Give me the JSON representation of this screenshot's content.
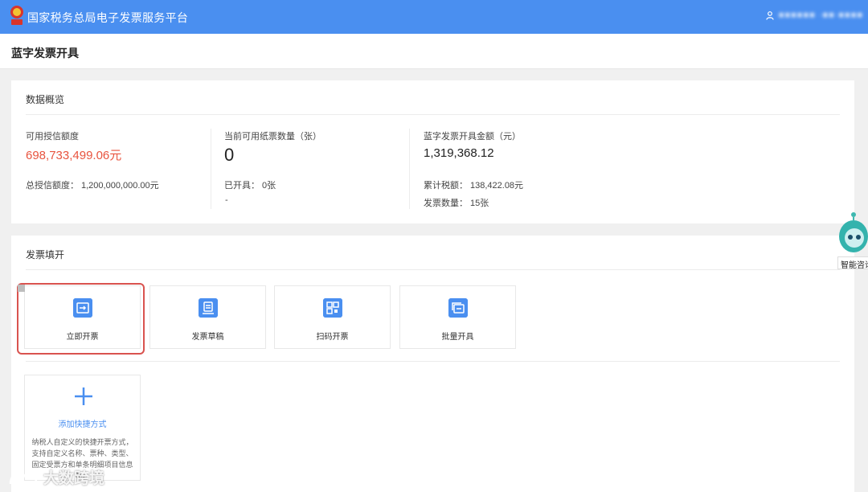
{
  "header": {
    "title": "国家税务总局电子发票服务平台",
    "user": "■■■■■■ ·■■·■■■■"
  },
  "page": {
    "title": "蓝字发票开具"
  },
  "overview": {
    "title": "数据概览",
    "credit": {
      "available_label": "可用授信额度",
      "available_value": "698,733,499.06元",
      "total_label": "总授信额度：",
      "total_value": "1,200,000,000.00元"
    },
    "paper": {
      "label": "当前可用纸票数量（张）",
      "value": "0",
      "issued_label": "已开具：",
      "issued_value": "0张",
      "dash": "-"
    },
    "blue": {
      "label": "蓝字发票开具金额（元）",
      "value": "1,319,368.12",
      "tax_label": "累计税额：",
      "tax_value": "138,422.08元",
      "count_label": "发票数量：",
      "count_value": "15张"
    }
  },
  "fill": {
    "title": "发票填开",
    "tiles": [
      {
        "label": "立即开票",
        "icon": "ticket-arrow-icon"
      },
      {
        "label": "发票草稿",
        "icon": "draft-icon"
      },
      {
        "label": "扫码开票",
        "icon": "qrcode-icon"
      },
      {
        "label": "批量开具",
        "icon": "batch-icon"
      }
    ],
    "add": {
      "label": "添加快捷方式",
      "desc": "纳税人自定义的快捷开票方式，支持自定义名称、票种、类型、固定受票方和单条明细项目信息等。"
    }
  },
  "assistant": {
    "label": "智能咨询"
  },
  "watermark": {
    "text": "大数跨境"
  },
  "colors": {
    "brand": "#4a8ff0",
    "highlight": "#e8543f",
    "selected_border": "#d9534f"
  }
}
